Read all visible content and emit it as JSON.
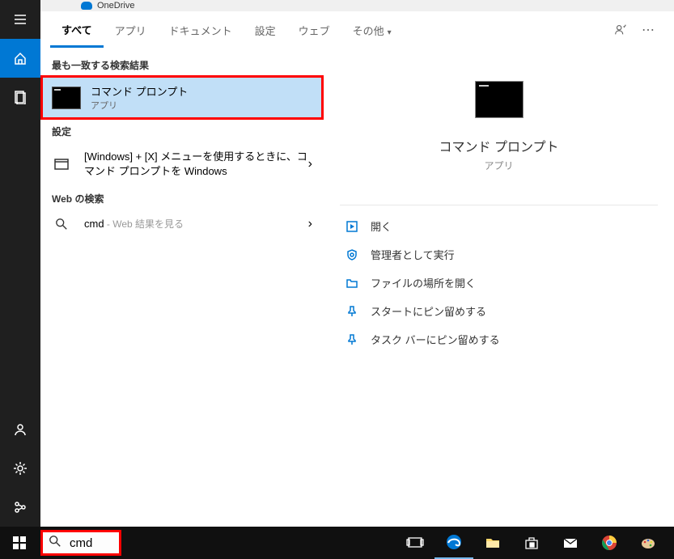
{
  "titlebar": {
    "app": "OneDrive"
  },
  "tabs": {
    "all": "すべて",
    "apps": "アプリ",
    "documents": "ドキュメント",
    "settings": "設定",
    "web": "ウェブ",
    "more": "その他"
  },
  "left": {
    "bestMatchLabel": "最も一致する検索結果",
    "result": {
      "title": "コマンド プロンプト",
      "sub": "アプリ"
    },
    "settingsLabel": "設定",
    "settingsItem": "[Windows] + [X] メニューを使用するときに、コマンド プロンプトを Windows",
    "webLabel": "Web の検索",
    "webQuery": "cmd",
    "webSuffix": " - Web 結果を見る"
  },
  "preview": {
    "title": "コマンド プロンプト",
    "sub": "アプリ"
  },
  "actions": {
    "open": "開く",
    "runAdmin": "管理者として実行",
    "openLocation": "ファイルの場所を開く",
    "pinStart": "スタートにピン留めする",
    "pinTaskbar": "タスク バーにピン留めする"
  },
  "search": {
    "value": "cmd"
  }
}
